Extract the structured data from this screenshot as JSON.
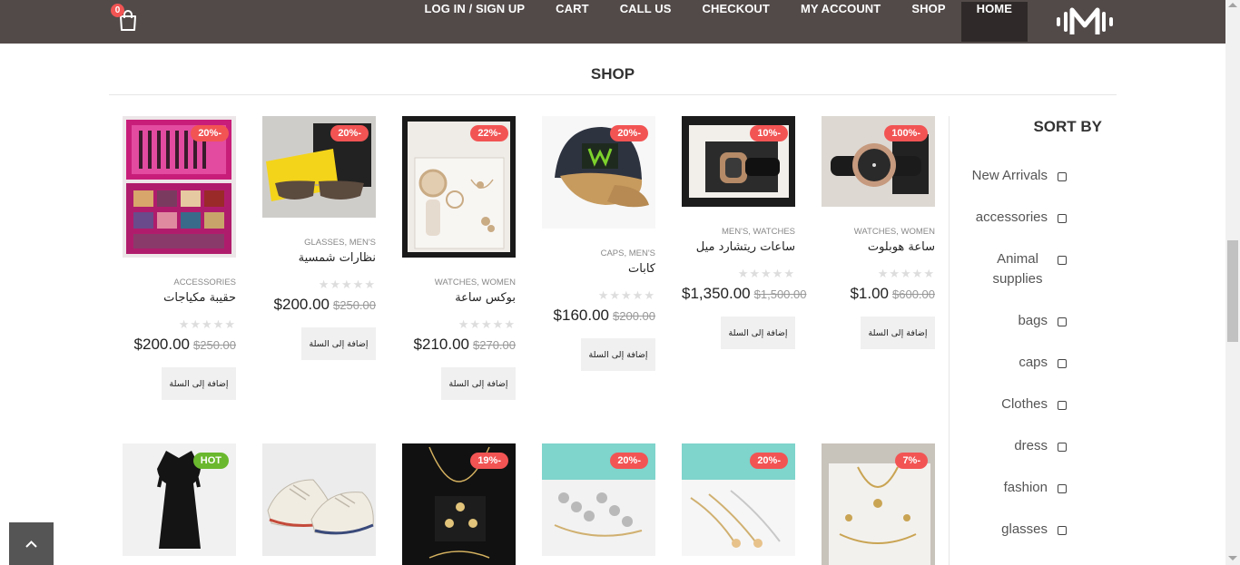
{
  "header": {
    "cart_count": "0",
    "nav": [
      "LOG IN / SIGN UP",
      "CART",
      "CALL US",
      "CHECKOUT",
      "MY ACCOUNT",
      "SHOP",
      "HOME"
    ],
    "active_item": "HOME",
    "bg_color": "#524a49",
    "active_color": "#2f2a29"
  },
  "page_title": "SHOP",
  "sidebar": {
    "title": "SORT BY",
    "filters": [
      "New Arrivals",
      "accessories",
      "Animal supplies",
      "bags",
      "caps",
      "Clothes",
      "dress",
      "fashion",
      "glasses"
    ]
  },
  "add_to_cart_label": "إضافة إلى السلة",
  "products": [
    {
      "badge": "100%-",
      "categories": "WATCHES, WOMEN",
      "name": "ساعة هوبلوت",
      "price": "$1.00",
      "old_price": "$600.00",
      "image": "watch-icon"
    },
    {
      "badge": "10%-",
      "categories": "MEN'S, WATCHES",
      "name": "ساعات ريتشارد ميل",
      "price": "$1,350.00",
      "old_price": "$1,500.00",
      "image": "watch-icon"
    },
    {
      "badge": "20%-",
      "categories": "CAPS, MEN'S",
      "name": "كابات",
      "price": "$160.00",
      "old_price": "$200.00",
      "image": "cap-icon"
    },
    {
      "badge": "22%-",
      "categories": "WATCHES, WOMEN",
      "name": "بوكس ساعة",
      "price": "$210.00",
      "old_price": "$270.00",
      "image": "watch-box-icon"
    },
    {
      "badge": "20%-",
      "categories": "GLASSES, MEN'S",
      "name": "نظارات شمسية",
      "price": "$200.00",
      "old_price": "$250.00",
      "image": "sunglasses-icon"
    },
    {
      "badge": "20%-",
      "categories": "ACCESSORIES",
      "name": "حقيبة مكياجات",
      "price": "$200.00",
      "old_price": "$250.00",
      "image": "makeup-case-icon"
    }
  ],
  "products_row2": [
    {
      "badge": "7%-",
      "image": "jewelry-set-icon"
    },
    {
      "badge": "20%-",
      "image": "bracelets-icon"
    },
    {
      "badge": "20%-",
      "image": "bracelets-icon"
    },
    {
      "badge": "19%-",
      "image": "necklace-icon"
    },
    {
      "badge": "",
      "image": "sneakers-icon"
    },
    {
      "badge": "HOT",
      "image": "dress-icon"
    }
  ],
  "colors": {
    "badge": "#f25454",
    "hot_badge": "#6ab82e"
  }
}
